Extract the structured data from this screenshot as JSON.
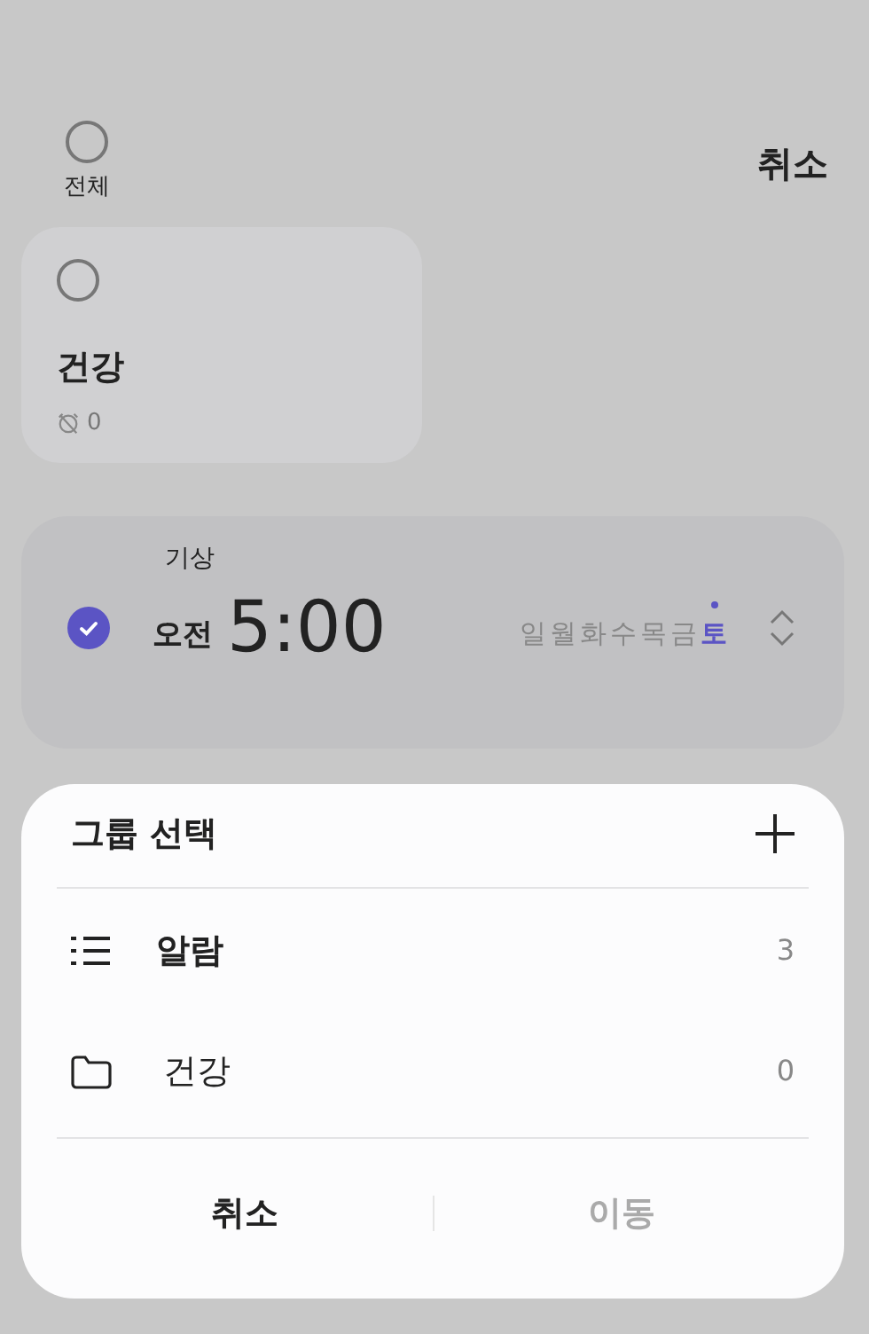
{
  "header": {
    "select_all": {
      "label": "전체",
      "checked": false
    },
    "cancel": "취소"
  },
  "groups": [
    {
      "name": "건강",
      "checked": false,
      "count": "0"
    }
  ],
  "alarms": [
    {
      "label": "기상",
      "checked": true,
      "ampm": "오전",
      "time": "5:00",
      "days": [
        {
          "label": "일",
          "selected": false
        },
        {
          "label": "월",
          "selected": false
        },
        {
          "label": "화",
          "selected": false
        },
        {
          "label": "수",
          "selected": false
        },
        {
          "label": "목",
          "selected": false
        },
        {
          "label": "금",
          "selected": false
        },
        {
          "label": "토",
          "selected": true
        }
      ]
    }
  ],
  "sheet": {
    "title": "그룹 선택",
    "items": [
      {
        "kind": "list",
        "label": "알람",
        "count": "3",
        "selected": true
      },
      {
        "kind": "folder",
        "label": "건강",
        "count": "0",
        "selected": false
      }
    ],
    "buttons": [
      {
        "label": "취소",
        "disabled": false
      },
      {
        "label": "이동",
        "disabled": true
      }
    ]
  }
}
